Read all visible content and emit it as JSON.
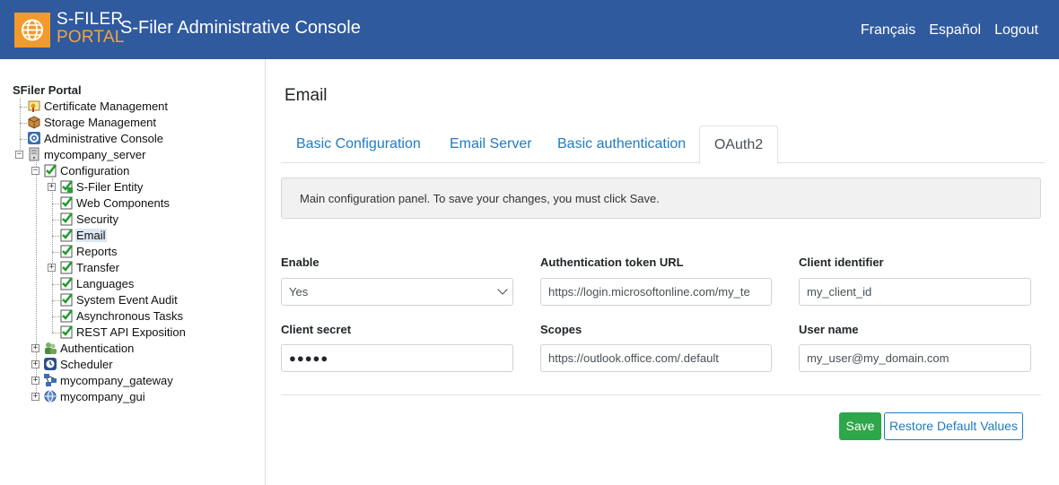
{
  "header": {
    "logo_line1": "S-FILER",
    "logo_line2": "PORTAL",
    "title": "S-Filer Administrative Console",
    "links": [
      "Français",
      "Español",
      "Logout"
    ]
  },
  "tree": {
    "root": "SFiler Portal",
    "items": [
      {
        "label": "Certificate Management",
        "icon": "certificate-icon"
      },
      {
        "label": "Storage Management",
        "icon": "storage-box-icon"
      },
      {
        "label": "Administrative Console",
        "icon": "gear-icon"
      },
      {
        "label": "mycompany_server",
        "icon": "server-icon"
      },
      {
        "label": "Configuration",
        "icon": "checklist-icon"
      },
      {
        "label": "S-Filer Entity",
        "icon": "entity-icon"
      },
      {
        "label": "Web Components",
        "icon": "checklist-icon"
      },
      {
        "label": "Security",
        "icon": "checklist-icon"
      },
      {
        "label": "Email",
        "icon": "checklist-icon"
      },
      {
        "label": "Reports",
        "icon": "checklist-icon"
      },
      {
        "label": "Transfer",
        "icon": "checklist-icon"
      },
      {
        "label": "Languages",
        "icon": "checklist-icon"
      },
      {
        "label": "System Event Audit",
        "icon": "checklist-icon"
      },
      {
        "label": "Asynchronous Tasks",
        "icon": "checklist-icon"
      },
      {
        "label": "REST API Exposition",
        "icon": "checklist-icon"
      },
      {
        "label": "Authentication",
        "icon": "users-icon"
      },
      {
        "label": "Scheduler",
        "icon": "clock-icon"
      },
      {
        "label": "mycompany_gateway",
        "icon": "gateway-icon"
      },
      {
        "label": "mycompany_gui",
        "icon": "gui-icon"
      }
    ],
    "selected": "Email"
  },
  "main": {
    "title": "Email",
    "tabs": [
      "Basic Configuration",
      "Email Server",
      "Basic authentication",
      "OAuth2"
    ],
    "active_tab": "OAuth2",
    "info": "Main configuration panel. To save your changes, you must click Save.",
    "fields": {
      "enable": {
        "label": "Enable",
        "value": "Yes"
      },
      "token_url": {
        "label": "Authentication token URL",
        "value": "https://login.microsoftonline.com/my_te"
      },
      "client_id": {
        "label": "Client identifier",
        "value": "my_client_id"
      },
      "client_secret": {
        "label": "Client secret",
        "value": "●●●●●"
      },
      "scopes": {
        "label": "Scopes",
        "value": "https://outlook.office.com/.default"
      },
      "user_name": {
        "label": "User name",
        "value": "my_user@my_domain.com"
      }
    },
    "save_label": "Save",
    "restore_label": "Restore Default Values"
  },
  "colors": {
    "header_bg": "#2f5a9e",
    "logo_orange": "#f39a2c",
    "link_blue": "#1f7bc1",
    "save_green": "#2ea64a"
  }
}
